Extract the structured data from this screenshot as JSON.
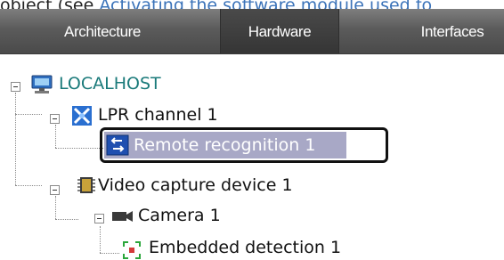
{
  "top_text": {
    "prefix": "object (see ",
    "link": "Activating the software module used fo"
  },
  "tabs": [
    {
      "label": "Architecture",
      "active": false
    },
    {
      "label": "Hardware",
      "active": true
    },
    {
      "label": "Interfaces",
      "active": false
    }
  ],
  "tree": {
    "localhost": "LOCALHOST",
    "lpr_channel": "LPR channel 1",
    "remote_recognition": "Remote recognition 1",
    "video_capture": "Video capture device 1",
    "camera": "Camera 1",
    "embedded_detection": "Embedded detection 1"
  },
  "colors": {
    "host_text": "#1a7a7a",
    "selection_bg": "#a8a8c6",
    "tab_bar": "#5b5b5b"
  }
}
